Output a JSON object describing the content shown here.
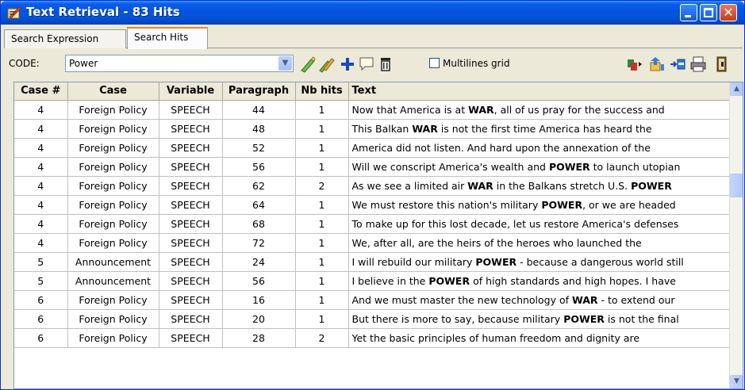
{
  "window": {
    "title": "Text Retrieval - 83 Hits",
    "close_glyph": "✕"
  },
  "tabs": [
    {
      "label": "Search Expression"
    },
    {
      "label": "Search Hits"
    }
  ],
  "toolbar": {
    "code_label": "CODE:",
    "code_value": "Power",
    "combo_arrow": "▼",
    "multilines_label": "Multilines grid",
    "icons": [
      "add-code-icon",
      "add-multiple-codes-icon",
      "plus-icon",
      "comment-icon",
      "delete-icon",
      "export-icon",
      "send-icon",
      "goto-icon",
      "print-icon",
      "exit-icon"
    ]
  },
  "grid": {
    "columns": [
      "Case #",
      "Case",
      "Variable",
      "Paragraph",
      "Nb hits",
      "Text"
    ],
    "rows": [
      {
        "case_no": "4",
        "case": "Foreign Policy",
        "variable": "SPEECH",
        "paragraph": "44",
        "hits": "1",
        "text": "Now that America is at <b>WAR</b>, all of us pray for the success and"
      },
      {
        "case_no": "4",
        "case": "Foreign Policy",
        "variable": "SPEECH",
        "paragraph": "48",
        "hits": "1",
        "text": "This Balkan <b>WAR</b> is not the first time America has heard the"
      },
      {
        "case_no": "4",
        "case": "Foreign Policy",
        "variable": "SPEECH",
        "paragraph": "52",
        "hits": "1",
        "text": "America did not listen. And hard upon the annexation of the"
      },
      {
        "case_no": "4",
        "case": "Foreign Policy",
        "variable": "SPEECH",
        "paragraph": "56",
        "hits": "1",
        "text": "Will we conscript America's wealth and <b>POWER</b> to launch utopian"
      },
      {
        "case_no": "4",
        "case": "Foreign Policy",
        "variable": "SPEECH",
        "paragraph": "62",
        "hits": "2",
        "text": "As we see a limited air <b>WAR</b> in the Balkans stretch U.S. <b>POWER</b>"
      },
      {
        "case_no": "4",
        "case": "Foreign Policy",
        "variable": "SPEECH",
        "paragraph": "64",
        "hits": "1",
        "text": "We must restore this nation's military <b>POWER</b>, or we are headed"
      },
      {
        "case_no": "4",
        "case": "Foreign Policy",
        "variable": "SPEECH",
        "paragraph": "68",
        "hits": "1",
        "text": "To make up for this lost decade, let us restore America's defenses"
      },
      {
        "case_no": "4",
        "case": "Foreign Policy",
        "variable": "SPEECH",
        "paragraph": "72",
        "hits": "1",
        "text": "We, after all, are the heirs of the heroes who launched the"
      },
      {
        "case_no": "5",
        "case": "Announcement",
        "variable": "SPEECH",
        "paragraph": "24",
        "hits": "1",
        "text": "I will rebuild our military <b>POWER</b> - because a dangerous world still"
      },
      {
        "case_no": "5",
        "case": "Announcement",
        "variable": "SPEECH",
        "paragraph": "56",
        "hits": "1",
        "text": "I believe in the <b>POWER</b> of high standards and high hopes. I have"
      },
      {
        "case_no": "6",
        "case": "Foreign Policy",
        "variable": "SPEECH",
        "paragraph": "16",
        "hits": "1",
        "text": "And we must master the new technology of <b>WAR</b> - to extend our"
      },
      {
        "case_no": "6",
        "case": "Foreign Policy",
        "variable": "SPEECH",
        "paragraph": "20",
        "hits": "1",
        "text": "But there is more to say, because military <b>POWER</b> is not the final"
      },
      {
        "case_no": "6",
        "case": "Foreign Policy",
        "variable": "SPEECH",
        "paragraph": "28",
        "hits": "2",
        "text": "Yet the basic principles of human freedom and dignity are"
      }
    ]
  },
  "scrollbar": {
    "up": "▲",
    "down": "▼"
  }
}
